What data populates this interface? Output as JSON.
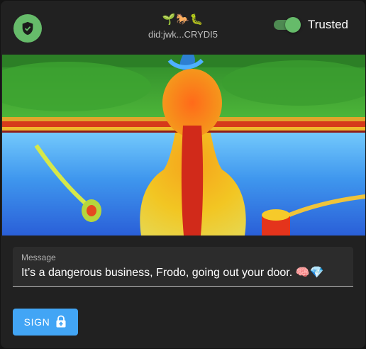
{
  "header": {
    "shield_icon": "shield-check-icon",
    "emoji": "🌱🐎🐛",
    "did": "did:jwk...CRYDI5",
    "trusted_label": "Trusted",
    "trusted_toggle_on": true
  },
  "image": {
    "description_icon": "abstract-painting-image"
  },
  "message": {
    "label": "Message",
    "value": "It’s a dangerous business, Frodo, going out your door. 🧠💎"
  },
  "actions": {
    "sign_label": "SIGN",
    "sign_icon": "lock-plus-icon"
  },
  "colors": {
    "background": "#212121",
    "accent_green": "#66bb6a",
    "button_blue": "#42a5f5"
  }
}
